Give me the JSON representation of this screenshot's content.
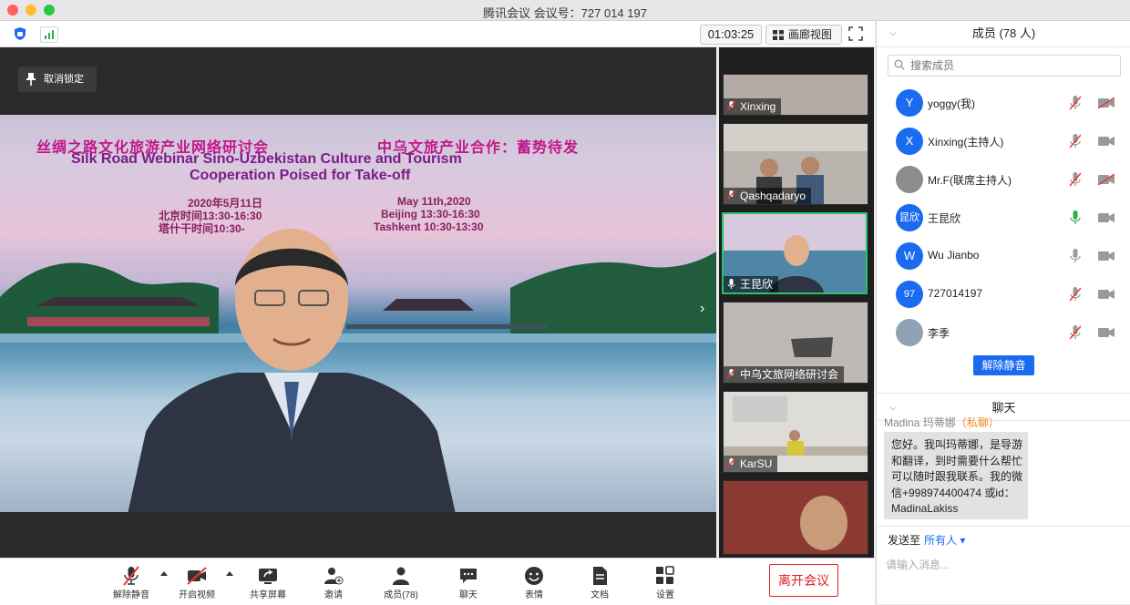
{
  "window": {
    "title": "腾讯会议 会议号：727 014 197"
  },
  "toolbar": {
    "timer": "01:03:25",
    "gallery_label": "画廊视图"
  },
  "main": {
    "unpin_label": "取消锁定",
    "slide": {
      "title_cn_1": "丝绸之路文化旅游产业网络研讨会",
      "title_cn_2": "中乌文旅产业合作：蓄势待发",
      "title_en_1": "Silk Road Webinar  Sino-Uzbekistan Culture and Tourism",
      "title_en_2": "Cooperation Poised for Take-off",
      "date_cn": "2020年5月11日",
      "time_beijing_cn": "北京时间13:30-16:30",
      "time_tashkent_cn": "塔什干时间10:30-",
      "date_en": "May 11th,2020",
      "time_beijing_en": "Beijing 13:30-16:30",
      "time_tashkent_en": "Tashkent 10:30-13:30"
    }
  },
  "thumbnails": [
    {
      "name": "Xinxing",
      "muted": true
    },
    {
      "name": "Qashqadaryo",
      "muted": true
    },
    {
      "name": "王昆欣",
      "muted": false,
      "active": true
    },
    {
      "name": "中乌文旅网络研讨会",
      "muted": true
    },
    {
      "name": "KarSU",
      "muted": true
    },
    {
      "name": "",
      "muted": true
    }
  ],
  "members": {
    "header": "成员 (78 人)",
    "search_placeholder": "搜索成员",
    "list": [
      {
        "avatar": "Y",
        "name": "yoggy(我)",
        "mic": "muted",
        "cam": "off"
      },
      {
        "avatar": "X",
        "name": "Xinxing(主持人)",
        "mic": "muted",
        "cam": "on"
      },
      {
        "avatar": "",
        "name": "Mr.F(联席主持人)",
        "mic": "muted",
        "cam": "off"
      },
      {
        "avatar": "昆欣",
        "name": "王昆欣",
        "mic": "active",
        "cam": "on"
      },
      {
        "avatar": "W",
        "name": "Wu Jianbo",
        "mic": "idle",
        "cam": "on"
      },
      {
        "avatar": "97",
        "name": "727014197",
        "mic": "muted",
        "cam": "on"
      },
      {
        "avatar": "",
        "name": "李季",
        "mic": "muted",
        "cam": "on"
      }
    ],
    "unmute_all": "解除静音"
  },
  "chat": {
    "header": "聊天",
    "sender": "Madina 玛蒂娜",
    "sender_tag": "（私聊）",
    "message": "您好。我叫玛蒂娜，是导游和翻译，到时需要什么帮忙可以随时跟我联系。我的微信+998974400474 或id：MadinaLakiss",
    "send_to_label": "发送至",
    "send_to_value": "所有人",
    "input_placeholder": "请输入消息..."
  },
  "bottombar": {
    "buttons": [
      "解除静音",
      "开启视频",
      "共享屏幕",
      "邀请",
      "成员(78)",
      "聊天",
      "表情",
      "文档",
      "设置"
    ],
    "leave": "离开会议"
  },
  "colors": {
    "accent": "#1a6bf0",
    "leave": "#e02020",
    "active_border": "#27c26b"
  }
}
